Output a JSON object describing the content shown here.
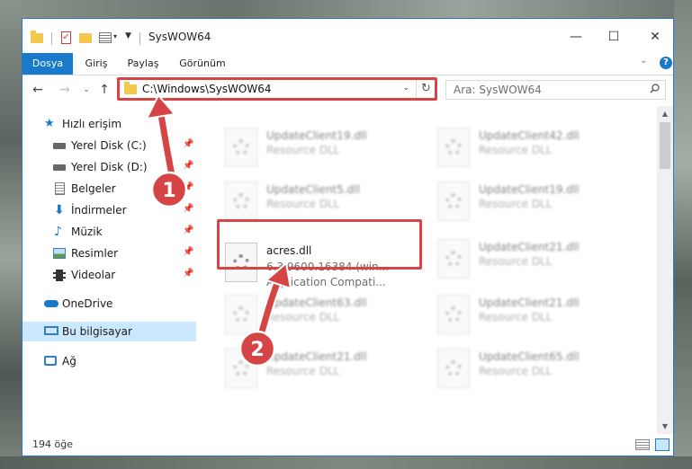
{
  "window": {
    "title": "SysWOW64",
    "controls": {
      "minimize": "—",
      "maximize": "☐",
      "close": "✕"
    }
  },
  "ribbon": {
    "tabs": [
      {
        "label": "Dosya"
      },
      {
        "label": "Giriş"
      },
      {
        "label": "Paylaş"
      },
      {
        "label": "Görünüm"
      }
    ],
    "help": "?"
  },
  "navigation": {
    "address": "C:\\Windows\\SysWOW64",
    "search_placeholder": "Ara: SysWOW64"
  },
  "sidebar": {
    "items": [
      {
        "label": "Hızlı erişim",
        "icon": "star-icon"
      },
      {
        "label": "Yerel Disk (C:)",
        "icon": "drive-icon",
        "pinned": true
      },
      {
        "label": "Yerel Disk (D:)",
        "icon": "drive-icon",
        "pinned": true
      },
      {
        "label": "Belgeler",
        "icon": "documents-icon",
        "pinned": true
      },
      {
        "label": "İndirmeler",
        "icon": "downloads-icon",
        "pinned": true
      },
      {
        "label": "Müzik",
        "icon": "music-icon",
        "pinned": true
      },
      {
        "label": "Resimler",
        "icon": "pictures-icon",
        "pinned": true
      },
      {
        "label": "Videolar",
        "icon": "videos-icon",
        "pinned": true
      },
      {
        "label": "OneDrive",
        "icon": "cloud-icon"
      },
      {
        "label": "Bu bilgisayar",
        "icon": "computer-icon",
        "selected": true
      },
      {
        "label": "Ağ",
        "icon": "network-icon"
      }
    ]
  },
  "files": [
    {
      "name": "UpdateClient19.dll",
      "line1": "Resource DLL"
    },
    {
      "name": "UpdateClient42.dll",
      "line1": "Resource DLL"
    },
    {
      "name": "UpdateClient5.dll",
      "line1": "Resource DLL"
    },
    {
      "name": "UpdateClient19.dll",
      "line1": "Resource DLL"
    },
    {
      "name": "acres.dll",
      "line1": "6.3.9600.16384 (win...",
      "line2": "Application Compati..."
    },
    {
      "name": "UpdateClient21.dll",
      "line1": "Resource DLL"
    },
    {
      "name": "UpdateClient63.dll",
      "line1": "Resource DLL"
    },
    {
      "name": "UpdateClient21.dll",
      "line1": "Resource DLL"
    },
    {
      "name": "UpdateClient21.dll",
      "line1": "Resource DLL"
    },
    {
      "name": "UpdateClient65.dll",
      "line1": "Resource DLL"
    }
  ],
  "status": {
    "item_count": "194 öğe"
  },
  "annotations": {
    "step1": "1",
    "step2": "2",
    "color": "#d64545"
  }
}
